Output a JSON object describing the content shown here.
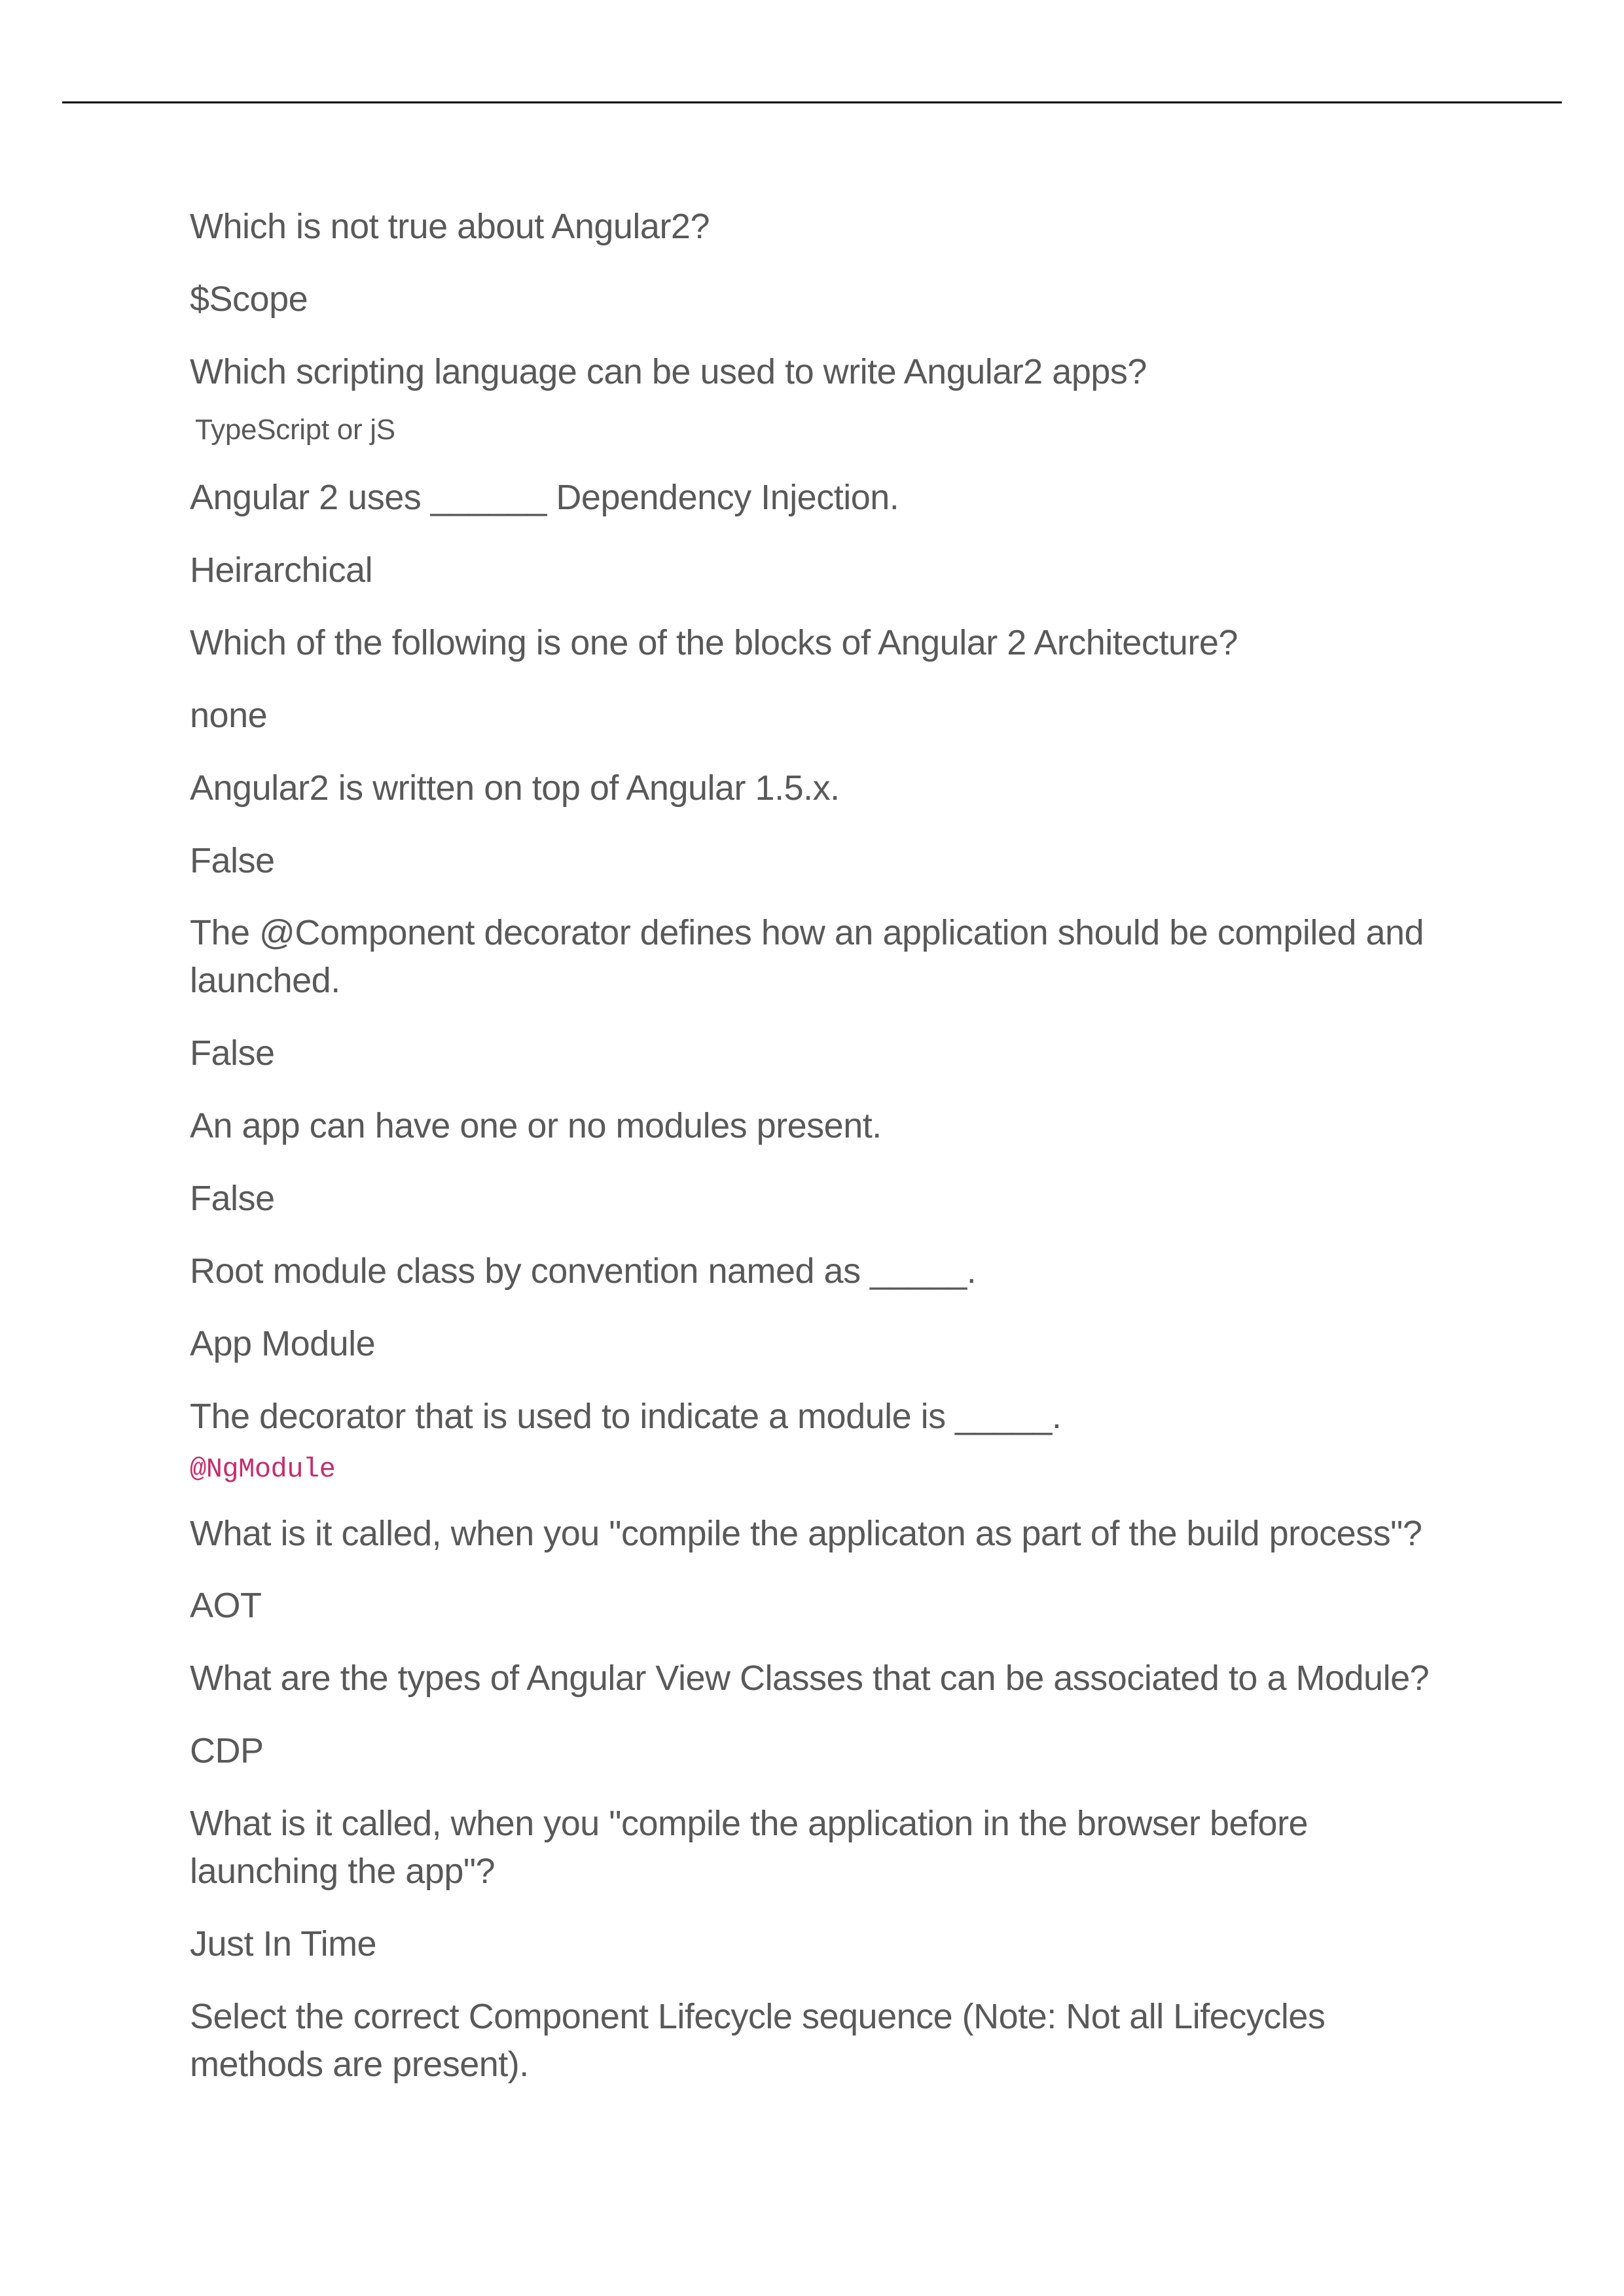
{
  "items": [
    {
      "q": "Which is not true about Angular2?",
      "a": "$Scope",
      "aClass": "answer"
    },
    {
      "q": "Which scripting language can be used to write Angular2 apps?",
      "a": "TypeScript or jS",
      "aClass": "answer-small"
    },
    {
      "q": "Angular 2 uses ______ Dependency Injection.",
      "a": "Heirarchical",
      "aClass": "answer"
    },
    {
      "q": "Which of the following is one of the blocks of Angular 2 Architecture?",
      "a": "none",
      "aClass": "answer"
    },
    {
      "q": "Angular2 is written on top of Angular 1.5.x.",
      "a": "False",
      "aClass": "answer"
    },
    {
      "q": "The @Component decorator defines how an application should be compiled and launched.",
      "a": "False",
      "aClass": "answer"
    },
    {
      "q": "An app can have one or no modules present.",
      "a": "False",
      "aClass": "answer"
    },
    {
      "q": "Root module class by convention named as _____.",
      "a": "App  Module",
      "aClass": "answer"
    },
    {
      "q": "The decorator that is used to indicate a module is _____.",
      "a": "@NgModule",
      "aClass": "answer-code"
    },
    {
      "q": "What is it called, when you \"compile the applicaton as part of the build process\"?",
      "a": "AOT",
      "aClass": "answer"
    },
    {
      "q": "What are the types of Angular View Classes that can be associated to a Module?",
      "a": "CDP",
      "aClass": "answer"
    },
    {
      "q": "What is it called, when you \"compile the application in the browser before launching the app\"?",
      "a": "Just In Time",
      "aClass": "answer"
    },
    {
      "q": "Select the correct Component Lifecycle sequence (Note: Not all Lifecycles methods are present).",
      "a": "",
      "aClass": "answer"
    }
  ]
}
